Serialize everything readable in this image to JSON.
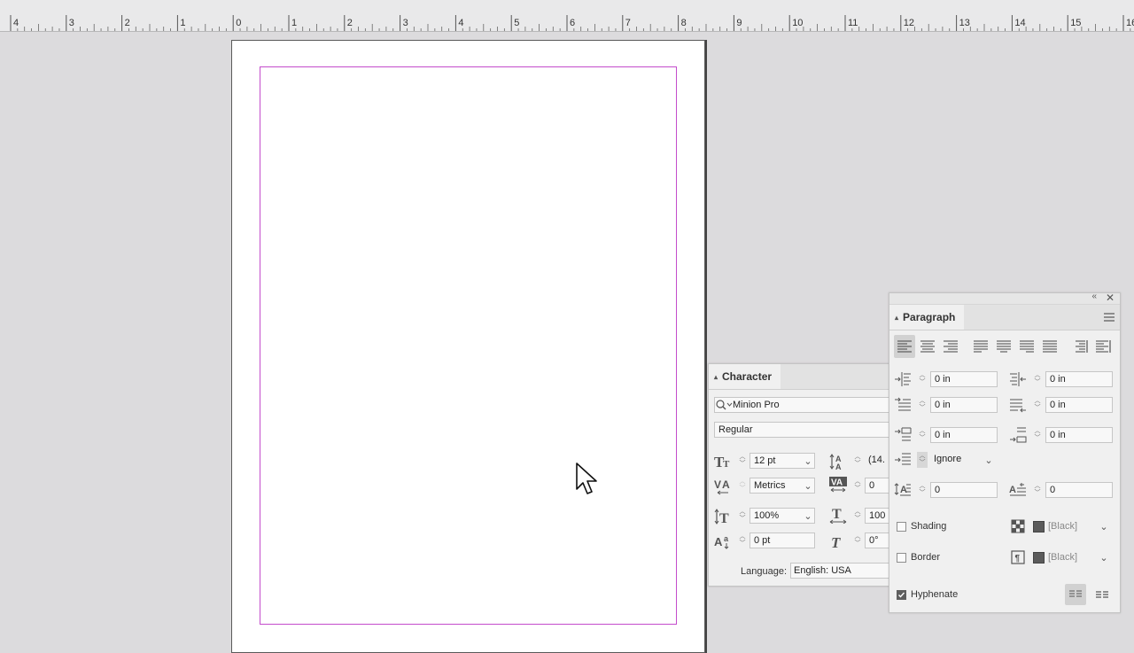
{
  "ruler": {
    "labels": [
      "4",
      "3",
      "2",
      "1",
      "0",
      "1",
      "2",
      "3",
      "4",
      "5",
      "6",
      "7",
      "8",
      "9",
      "10",
      "11",
      "12",
      "13",
      "14",
      "15",
      "16"
    ]
  },
  "character_panel": {
    "tab_title": "Character",
    "font_family": "Minion Pro",
    "font_style": "Regular",
    "font_size": "12 pt",
    "leading": "(14.",
    "kerning": "Metrics",
    "tracking": "0",
    "vertical_scale": "100%",
    "horizontal_scale": "100",
    "baseline_shift": "0 pt",
    "skew": "0°",
    "language_label": "Language:",
    "language": "English: USA"
  },
  "paragraph_panel": {
    "tab_title": "Paragraph",
    "left_indent": "0 in",
    "right_indent": "0 in",
    "first_line_indent": "0 in",
    "last_line_indent": "0 in",
    "space_before": "0 in",
    "space_after": "0 in",
    "align_to_grid": "Ignore",
    "drop_cap_lines": "0",
    "drop_cap_chars": "0",
    "shading_label": "Shading",
    "shading_color": "[Black]",
    "border_label": "Border",
    "border_color": "[Black]",
    "hyphenate_label": "Hyphenate",
    "hyphenate_checked": true,
    "shading_checked": false,
    "border_checked": false,
    "selected_alignment": "align-left"
  },
  "colors": {
    "margin_guide": "#c44ccc",
    "pasteboard": "#dcdbdd",
    "panel_bg": "#f0f0f0"
  }
}
